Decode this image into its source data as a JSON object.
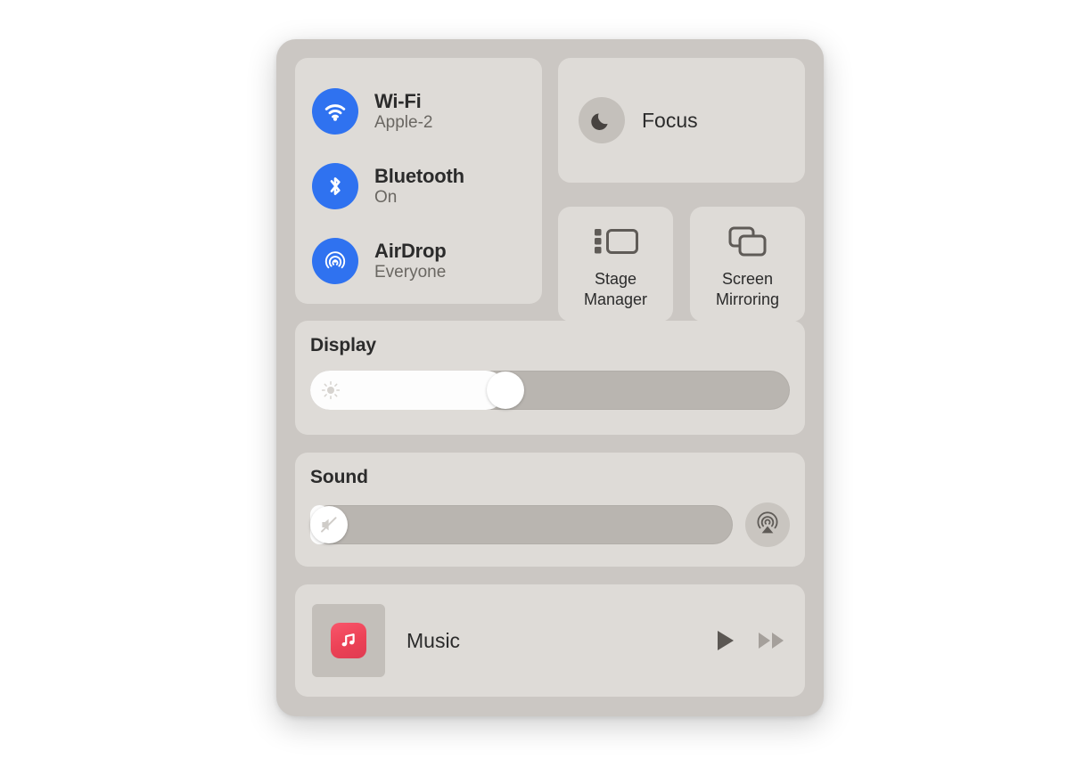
{
  "panel": {
    "name": "Control Center",
    "background_color": "#cbc7c3",
    "tile_color": "#dedbd7",
    "accent_color": "#2f72f0"
  },
  "connectivity": {
    "items": [
      {
        "icon": "wifi-icon",
        "title": "Wi-Fi",
        "status": "Apple-2",
        "enabled": true
      },
      {
        "icon": "bluetooth-icon",
        "title": "Bluetooth",
        "status": "On",
        "enabled": true
      },
      {
        "icon": "airdrop-icon",
        "title": "AirDrop",
        "status": "Everyone",
        "enabled": true
      }
    ]
  },
  "focus": {
    "label": "Focus",
    "icon": "moon-icon"
  },
  "stage_manager": {
    "label_line1": "Stage",
    "label_line2": "Manager",
    "icon": "stage-manager-icon"
  },
  "screen_mirroring": {
    "label_line1": "Screen",
    "label_line2": "Mirroring",
    "icon": "screen-mirroring-icon"
  },
  "display": {
    "label": "Display",
    "brightness_percent": 40,
    "knob_icon": "brightness-icon"
  },
  "sound": {
    "label": "Sound",
    "volume_percent": 0,
    "muted": true,
    "knob_icon": "speaker-mute-icon",
    "airplay_icon": "airplay-audio-icon"
  },
  "music": {
    "app_name": "Music",
    "app_icon": "music-note-icon",
    "play_icon": "play-icon",
    "next_icon": "fast-forward-icon"
  }
}
